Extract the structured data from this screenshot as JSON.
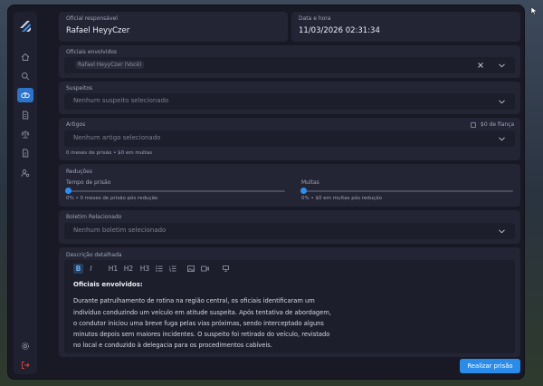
{
  "oficial": {
    "label": "Oficial responsável",
    "value": "Rafael HeyyCzer"
  },
  "data_hora": {
    "label": "Data e hora",
    "value": "11/03/2026 02:31:34"
  },
  "oficiais": {
    "label": "Oficiais envolvidos",
    "chip": "Rafael HeyyCzer (Você)"
  },
  "suspeitos": {
    "label": "Suspeitos",
    "placeholder": "Nenhum suspeito selecionado"
  },
  "artigos": {
    "label": "Artigos",
    "placeholder": "Nenhum artigo selecionado",
    "fianca_label": "$0 de fiança",
    "summary": "0 meses de prisão • $0 em multas"
  },
  "reducoes": {
    "label": "Reduções",
    "tempo_label": "Tempo de prisão",
    "tempo_summary": "0% • 0 meses de prisão pós redução",
    "tempo_value": 0,
    "multas_label": "Multas",
    "multas_summary": "0% • $0 em multas pós redução",
    "multas_value": 0
  },
  "boletim": {
    "label": "Boletim Relacionado",
    "placeholder": "Nenhum boletim selecionado"
  },
  "descricao": {
    "label": "Descrição detalhada",
    "toolbar": [
      "B",
      "I",
      "H1",
      "H2",
      "H3"
    ],
    "title": "Oficiais envolvidos:",
    "lines": [
      "Durante patrulhamento de rotina na região central, os oficiais identificaram um",
      "indivíduo conduzindo um veículo em atitude suspeita. Após tentativa de abordagem,",
      "o condutor iniciou uma breve fuga pelas vias próximas, sendo interceptado alguns",
      "minutos depois sem maiores incidentes. O suspeito foi retirado do veículo, revistado",
      "no local e conduzido à delegacia para os procedimentos cabíveis."
    ]
  },
  "submit_label": "Realizar prisão",
  "icons": {
    "sidebar": [
      "home-icon",
      "search-icon",
      "handcuffs-icon",
      "document-icon",
      "scales-icon",
      "file-icon",
      "user-settings-icon",
      "settings-icon",
      "logout-icon"
    ]
  },
  "colors": {
    "accent": "#2b8be8",
    "logout": "#e0443e",
    "panel": "#232535"
  }
}
